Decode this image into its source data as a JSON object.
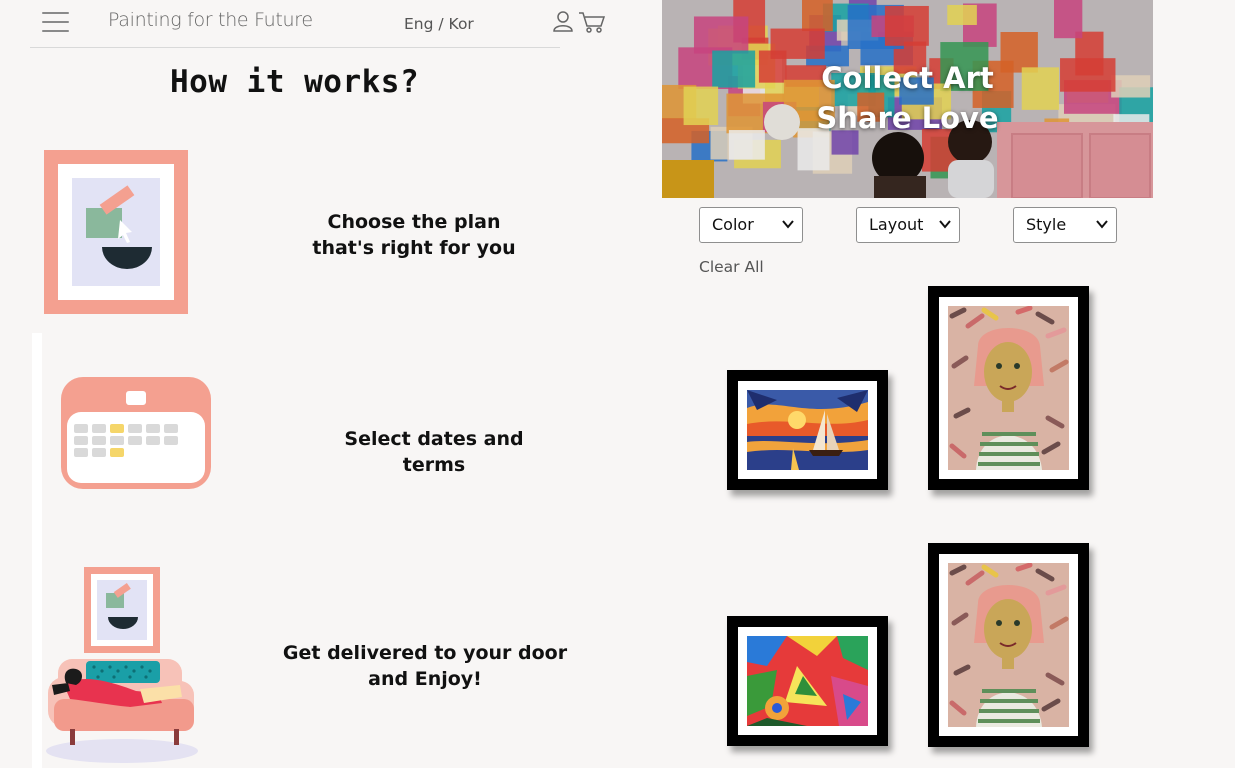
{
  "header": {
    "brand": "Painting for the Future",
    "lang_eng": "Eng",
    "lang_sep": " / ",
    "lang_kor": "Kor"
  },
  "how_it_works": {
    "title": "How it works?",
    "steps": [
      {
        "line1": "Choose the plan",
        "line2": "that's right for you",
        "icon": "framed-art-icon"
      },
      {
        "line1": "Select dates and terms",
        "icon": "calendar-icon"
      },
      {
        "line1": "Get delivered to your door",
        "line2": "and Enjoy!",
        "icon": "delivery-sofa-icon"
      }
    ]
  },
  "hero": {
    "line1": "Collect Art",
    "line2": "Share Love"
  },
  "filters": {
    "color_label": "Color",
    "layout_label": "Layout",
    "style_label": "Style",
    "clear_label": "Clear All"
  },
  "colors": {
    "background": "#f8f6f5",
    "frame": "#000000",
    "accent_salmon": "#f4a090"
  },
  "gallery": [
    {
      "name": "sunset-sailboat-painting"
    },
    {
      "name": "girl-portrait-painting"
    },
    {
      "name": "abstract-colorful-painting"
    },
    {
      "name": "girl-portrait-painting"
    }
  ]
}
